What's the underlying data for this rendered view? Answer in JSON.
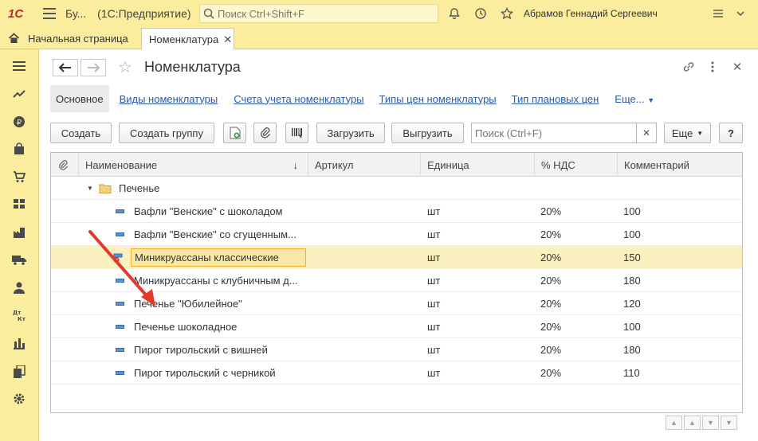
{
  "app": {
    "logo": "1С",
    "title": "Бу...",
    "subtitle": "(1С:Предприятие)",
    "search_placeholder": "Поиск Ctrl+Shift+F",
    "user": "Абрамов Геннадий Сергеевич"
  },
  "tabs": {
    "home": "Начальная страница",
    "active": "Номенклатура"
  },
  "page": {
    "title": "Номенклатура"
  },
  "section_tabs": {
    "active": "Основное",
    "links": [
      "Виды номенклатуры",
      "Счета учета номенклатуры",
      "Типы цен номенклатуры",
      "Тип плановых цен"
    ],
    "more": "Еще..."
  },
  "toolbar": {
    "create": "Создать",
    "create_group": "Создать группу",
    "load": "Загрузить",
    "unload": "Выгрузить",
    "search_placeholder": "Поиск (Ctrl+F)",
    "more": "Еще",
    "help": "?"
  },
  "grid": {
    "columns": [
      "Наименование",
      "Артикул",
      "Единица",
      "% НДС",
      "Комментарий"
    ],
    "group": "Печенье",
    "rows": [
      {
        "name": "Вафли \"Венские\" с шоколадом",
        "article": "",
        "unit": "шт",
        "vat": "20%",
        "comment": "100"
      },
      {
        "name": "Вафли \"Венские\" со сгущенным...",
        "article": "",
        "unit": "шт",
        "vat": "20%",
        "comment": "100"
      },
      {
        "name": "Миникруассаны классические",
        "article": "",
        "unit": "шт",
        "vat": "20%",
        "comment": "150"
      },
      {
        "name": "Миникруассаны с клубничным д...",
        "article": "",
        "unit": "шт",
        "vat": "20%",
        "comment": "180"
      },
      {
        "name": "Печенье \"Юбилейное\"",
        "article": "",
        "unit": "шт",
        "vat": "20%",
        "comment": "120"
      },
      {
        "name": "Печенье шоколадное",
        "article": "",
        "unit": "шт",
        "vat": "20%",
        "comment": "100"
      },
      {
        "name": "Пирог тирольский с вишней",
        "article": "",
        "unit": "шт",
        "vat": "20%",
        "comment": "180"
      },
      {
        "name": "Пирог тирольский с черникой",
        "article": "",
        "unit": "шт",
        "vat": "20%",
        "comment": "110"
      }
    ]
  },
  "colors": {
    "accent": "#fbed9e",
    "link": "#2b5aa8",
    "selected_row": "#fbf0bf",
    "annotation_arrow": "#e23b2e"
  }
}
